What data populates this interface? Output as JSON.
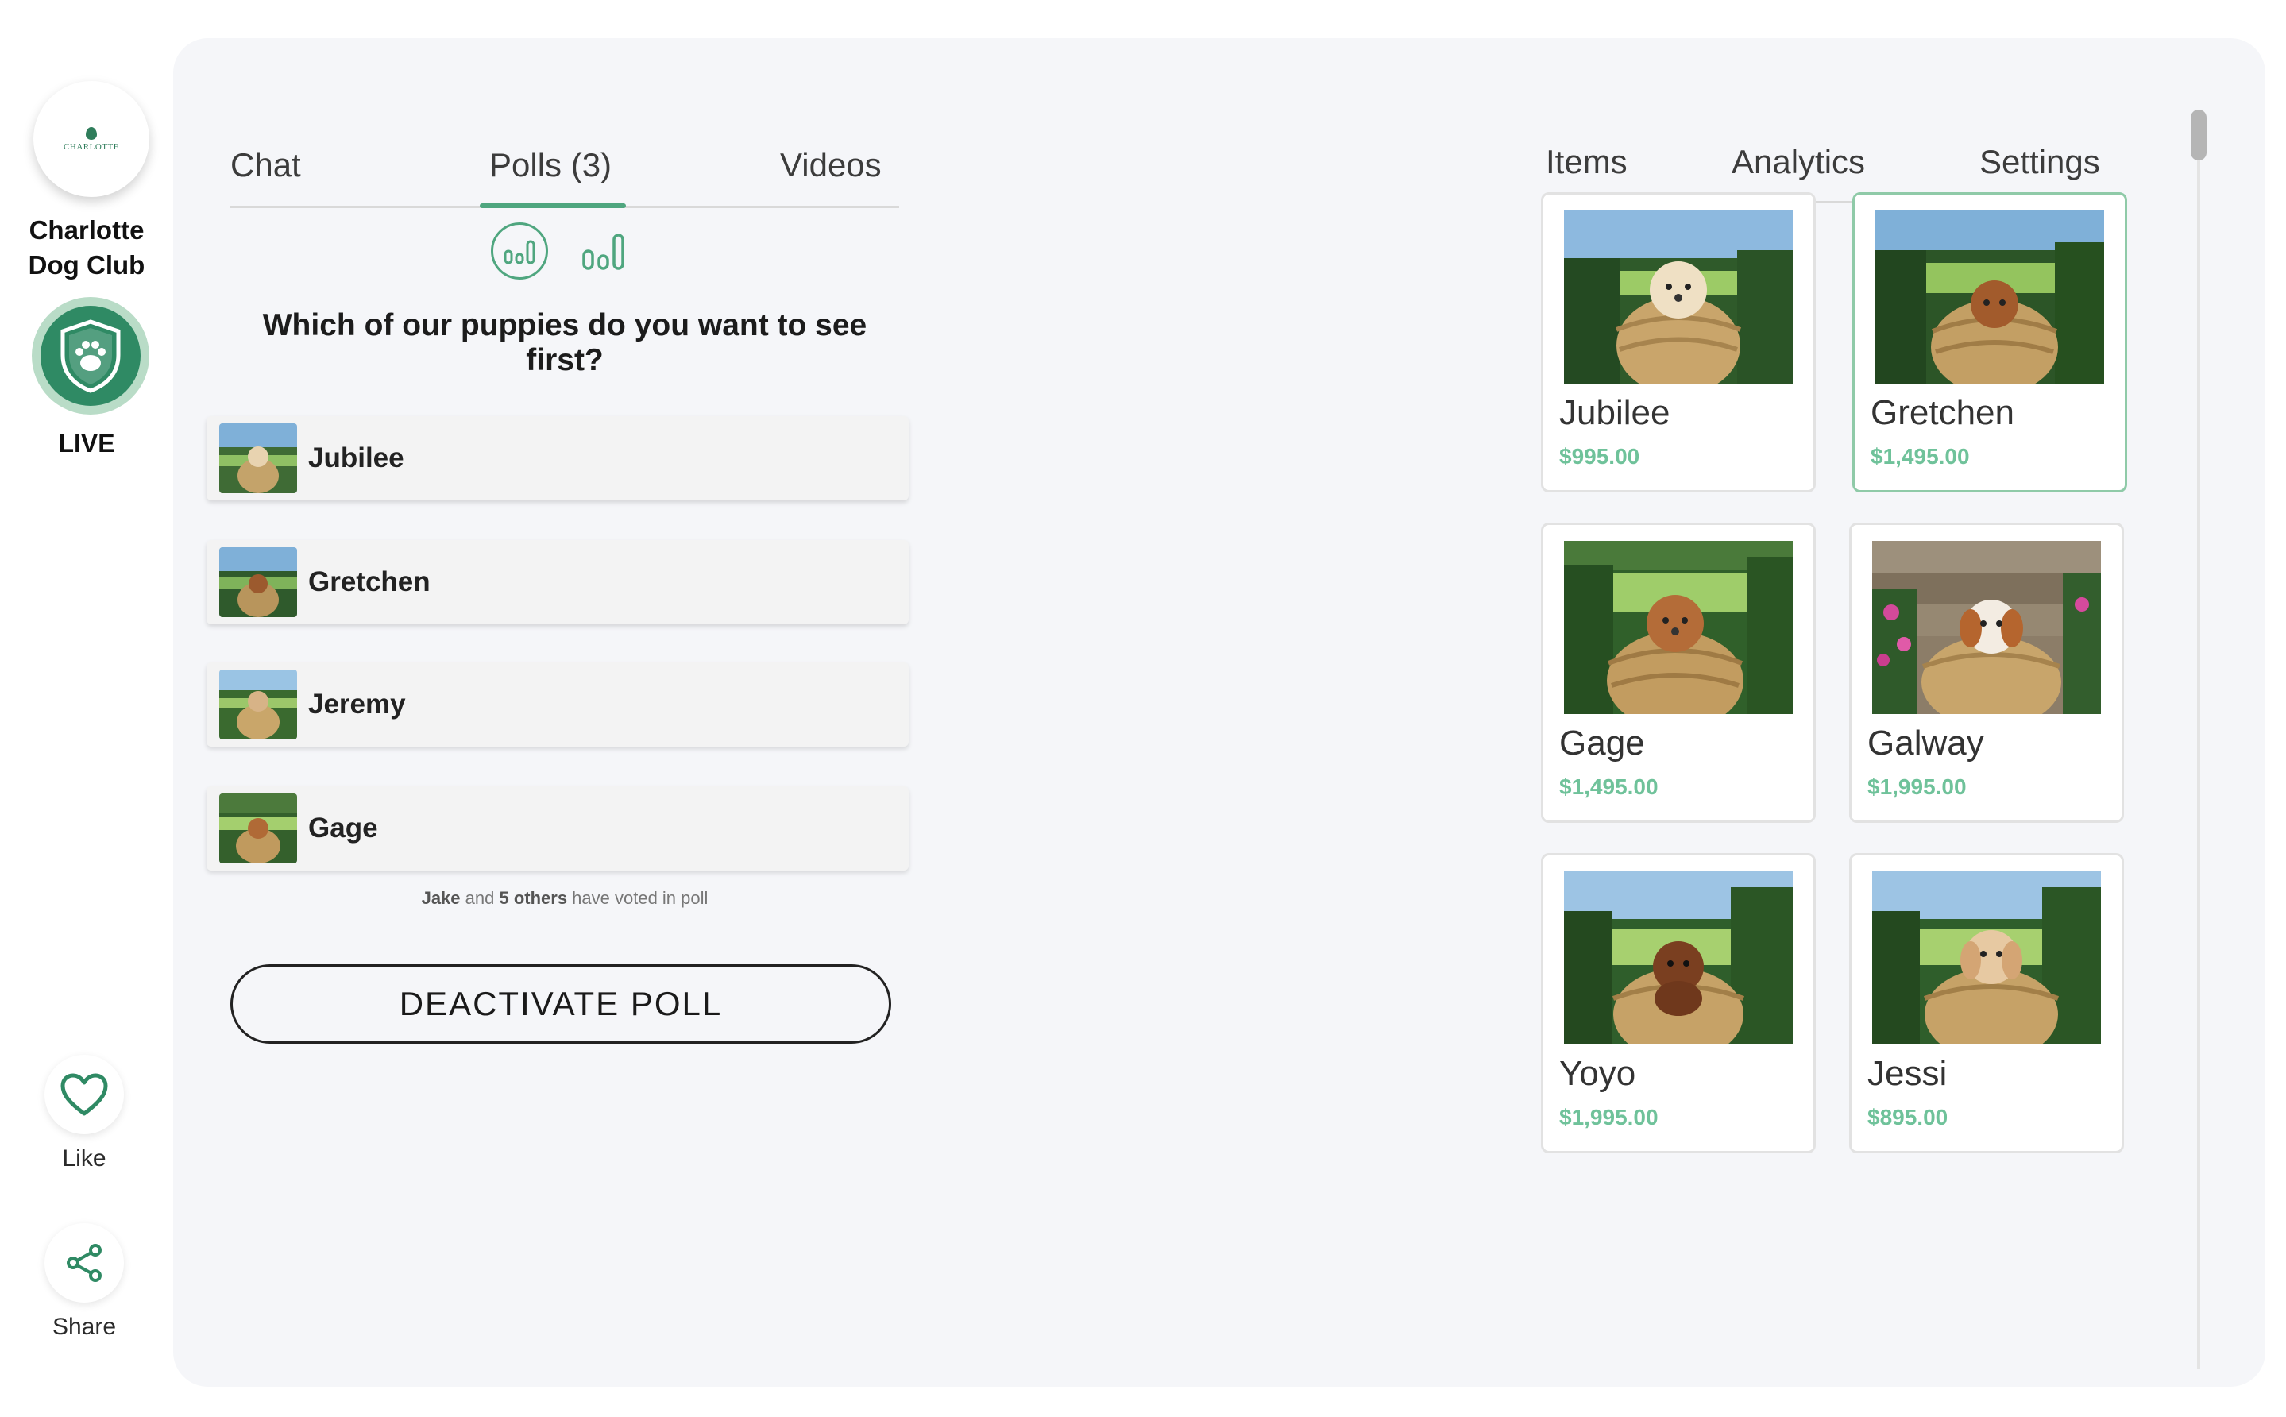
{
  "brand": {
    "name": "Charlotte Dog Club",
    "name_line1": "Charlotte",
    "name_line2": "Dog Club",
    "logo_text": "CHARLOTTE",
    "live_label": "LIVE"
  },
  "actions": {
    "like_label": "Like",
    "share_label": "Share"
  },
  "left_tabs": [
    {
      "label": "Chat",
      "active": false
    },
    {
      "label": "Polls (3)",
      "active": true
    },
    {
      "label": "Videos",
      "active": false
    }
  ],
  "poll": {
    "question": "Which of our puppies do you want to see first?",
    "options": [
      {
        "name": "Jubilee"
      },
      {
        "name": "Gretchen"
      },
      {
        "name": "Jeremy"
      },
      {
        "name": "Gage"
      }
    ],
    "votes_lead": "Jake",
    "votes_and": " and ",
    "votes_others": "5 others",
    "votes_tail": " have voted in poll",
    "deactivate_label": "DEACTIVATE POLL"
  },
  "right_tabs": [
    {
      "label": "Items",
      "active": true
    },
    {
      "label": "Analytics",
      "active": false
    },
    {
      "label": "Settings",
      "active": false
    }
  ],
  "items": [
    {
      "name": "Jubilee",
      "price": "$995.00",
      "selected": false
    },
    {
      "name": "Gretchen",
      "price": "$1,495.00",
      "selected": true
    },
    {
      "name": "Gage",
      "price": "$1,495.00",
      "selected": false
    },
    {
      "name": "Galway",
      "price": "$1,995.00",
      "selected": false
    },
    {
      "name": "Yoyo",
      "price": "$1,995.00",
      "selected": false
    },
    {
      "name": "Jessi",
      "price": "$895.00",
      "selected": false
    }
  ],
  "colors": {
    "accent": "#4fa67f",
    "price": "#6fc29a",
    "panel": "#f5f6f9"
  }
}
